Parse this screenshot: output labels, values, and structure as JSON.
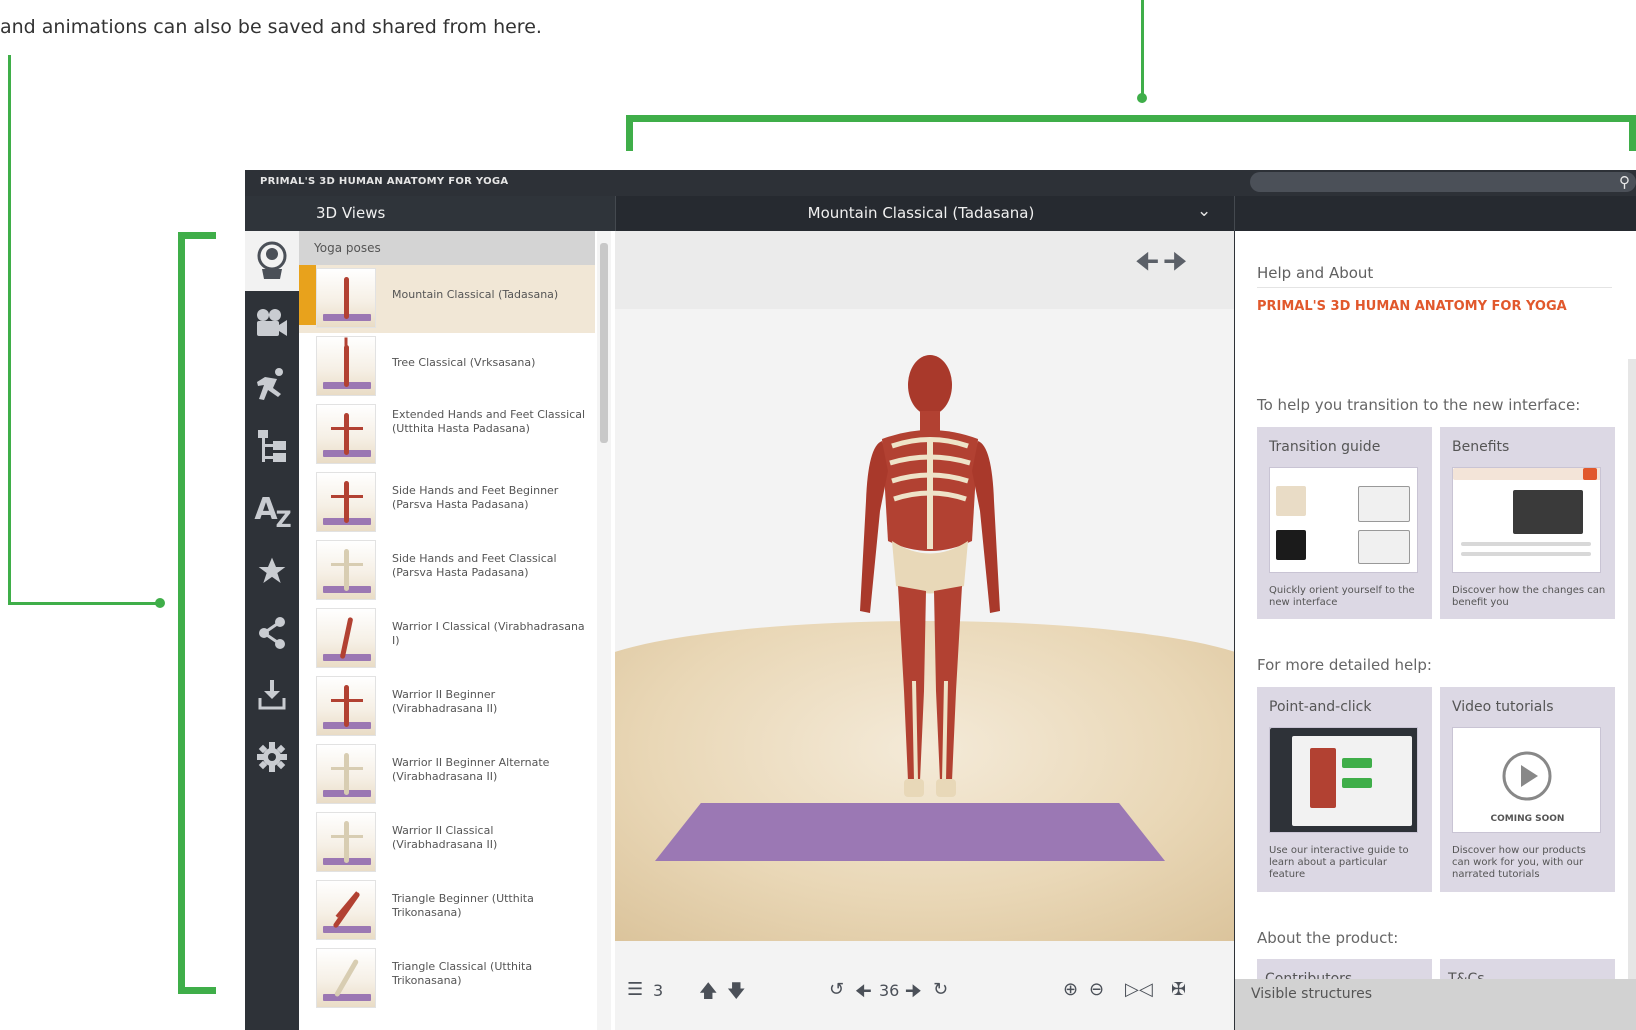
{
  "caption": "and animations can also be saved and shared from here.",
  "app": {
    "title": "PRIMAL'S 3D HUMAN ANATOMY FOR YOGA",
    "views_label": "3D Views",
    "current_pose": "Mountain Classical (Tadasana)"
  },
  "sidebar_icons": [
    "views-icon",
    "camera-icon",
    "running-figure-icon",
    "tree-hierarchy-icon",
    "a-z-icon",
    "star-icon",
    "share-icon",
    "download-icon",
    "gear-icon"
  ],
  "list": {
    "header": "Yoga poses",
    "items": [
      {
        "label": "Mountain Classical (Tadasana)",
        "selected": true
      },
      {
        "label": "Tree Classical (Vrksasana)"
      },
      {
        "label": "Extended Hands and Feet Classical (Utthita Hasta Padasana)"
      },
      {
        "label": "Side Hands and Feet Beginner (Parsva Hasta Padasana)"
      },
      {
        "label": "Side Hands and Feet Classical (Parsva Hasta Padasana)"
      },
      {
        "label": "Warrior I Classical (Virabhadrasana I)"
      },
      {
        "label": "Warrior II Beginner (Virabhadrasana II)"
      },
      {
        "label": "Warrior II Beginner Alternate (Virabhadrasana II)"
      },
      {
        "label": "Warrior II Classical (Virabhadrasana II)"
      },
      {
        "label": "Triangle Beginner (Utthita Trikonasana)"
      },
      {
        "label": "Triangle Classical (Utthita Trikonasana)"
      }
    ]
  },
  "viewer": {
    "layers_count": "3",
    "rotation_step": "36"
  },
  "help": {
    "heading": "Help and About",
    "product": "PRIMAL'S 3D HUMAN ANATOMY FOR YOGA",
    "transition_heading": "To help you transition to the new interface:",
    "detailed_heading": "For more detailed help:",
    "about_heading": "About the product:",
    "cards": [
      {
        "title": "Transition guide",
        "desc": "Quickly orient yourself to the new interface"
      },
      {
        "title": "Benefits",
        "desc": "Discover how the changes can benefit you"
      },
      {
        "title": "Point-and-click",
        "desc": "Use our interactive guide to learn about a particular feature"
      },
      {
        "title": "Video tutorials",
        "desc": "Discover how our products can work for you, with our narrated tutorials",
        "badge": "COMING SOON"
      }
    ],
    "about_cards": [
      "Contributors",
      "T&Cs"
    ],
    "visible_structures": "Visible structures"
  },
  "colors": {
    "accent_green": "#3fae49",
    "selection_orange": "#e8a21c",
    "product_orange": "#e1582c",
    "mat_purple": "#9b78b4",
    "muscle_red": "#b24132"
  }
}
